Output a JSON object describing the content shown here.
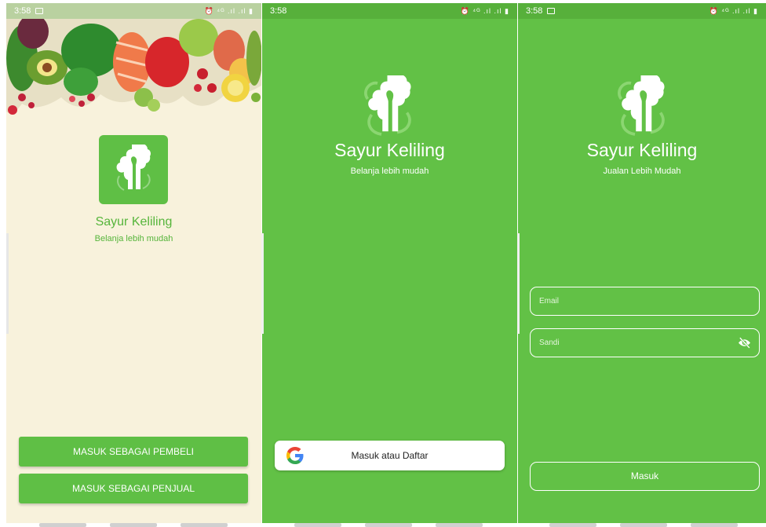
{
  "status": {
    "time": "3:58",
    "right_icons": "⏰ ⁴ᴳ .ıl .ıl ▮"
  },
  "screen1": {
    "title": "Sayur Keliling",
    "subtitle": "Belanja lebih mudah",
    "buyer_button": "MASUK SEBAGAI PEMBELI",
    "seller_button": "MASUK SEBAGAI PENJUAL"
  },
  "screen2": {
    "title": "Sayur Keliling",
    "subtitle": "Belanja lebih mudah",
    "google_button": "Masuk atau Daftar"
  },
  "screen3": {
    "title": "Sayur Keliling",
    "subtitle": "Jualan Lebih Mudah",
    "email_placeholder": "Email",
    "password_placeholder": "Sandi",
    "login_button": "Masuk"
  },
  "colors": {
    "brand_green": "#62c146",
    "cream": "#f8f2dc"
  }
}
